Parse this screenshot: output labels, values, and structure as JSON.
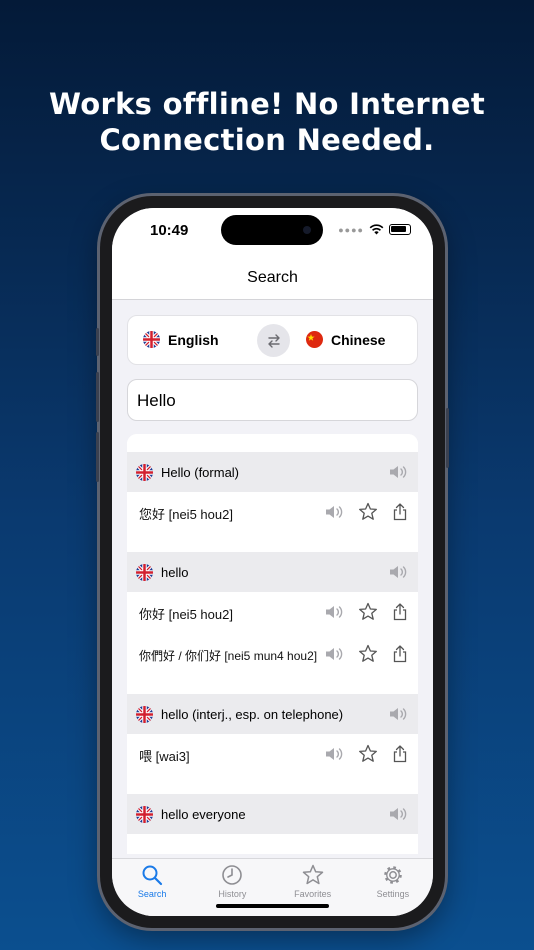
{
  "headline": {
    "line1": "Works offline! No Internet",
    "line2": "Connection Needed."
  },
  "status_bar": {
    "time": "10:49"
  },
  "nav": {
    "title": "Search"
  },
  "languages": {
    "source": "English",
    "target": "Chinese"
  },
  "search": {
    "value": "Hello"
  },
  "entries": [
    {
      "term": "Hello (formal)",
      "translations": [
        "您好 [nei5 hou2]"
      ]
    },
    {
      "term": "hello",
      "translations": [
        "你好 [nei5 hou2]",
        "你們好 / 你们好 [nei5 mun4 hou2]"
      ]
    },
    {
      "term": "hello (interj., esp. on telephone)",
      "translations": [
        "喂 [wai3]"
      ]
    },
    {
      "term": "hello everyone",
      "translations": []
    }
  ],
  "tabs": {
    "search": "Search",
    "history": "History",
    "favorites": "Favorites",
    "settings": "Settings"
  },
  "colors": {
    "accent": "#1a7ae8",
    "background_top": "#041a38",
    "background_bottom": "#0b4f8f"
  }
}
